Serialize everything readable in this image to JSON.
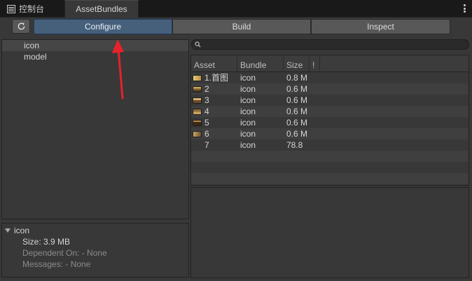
{
  "tabs": [
    {
      "label": "控制台",
      "icon": "console-icon"
    },
    {
      "label": "AssetBundles"
    }
  ],
  "toolbar": {
    "refresh_icon": "refresh-icon",
    "modes": [
      "Configure",
      "Build",
      "Inspect"
    ],
    "active_mode": "Configure"
  },
  "bundles": [
    "icon",
    "model"
  ],
  "selected_bundle": "icon",
  "details": {
    "name": "icon",
    "size": "Size: 3.9 MB",
    "dependent_on": "Dependent On: - None",
    "messages": "Messages: - None"
  },
  "search": {
    "value": "",
    "placeholder": ""
  },
  "asset_table": {
    "headers": {
      "asset": "Asset",
      "bundle": "Bundle",
      "size": "Size",
      "extra": "!"
    },
    "rows": [
      {
        "asset": "1.首图",
        "bundle": "icon",
        "size": "0.8 M"
      },
      {
        "asset": "2",
        "bundle": "icon",
        "size": "0.6 M"
      },
      {
        "asset": "3",
        "bundle": "icon",
        "size": "0.6 M"
      },
      {
        "asset": "4",
        "bundle": "icon",
        "size": "0.6 M"
      },
      {
        "asset": "5",
        "bundle": "icon",
        "size": "0.6 M"
      },
      {
        "asset": "6",
        "bundle": "icon",
        "size": "0.6 M"
      },
      {
        "asset": "7",
        "bundle": "icon",
        "size": "78.8"
      }
    ]
  },
  "colors": {
    "active_tab": "#46607c",
    "panel_bg": "#383838",
    "annotation_arrow": "#e8212b"
  }
}
